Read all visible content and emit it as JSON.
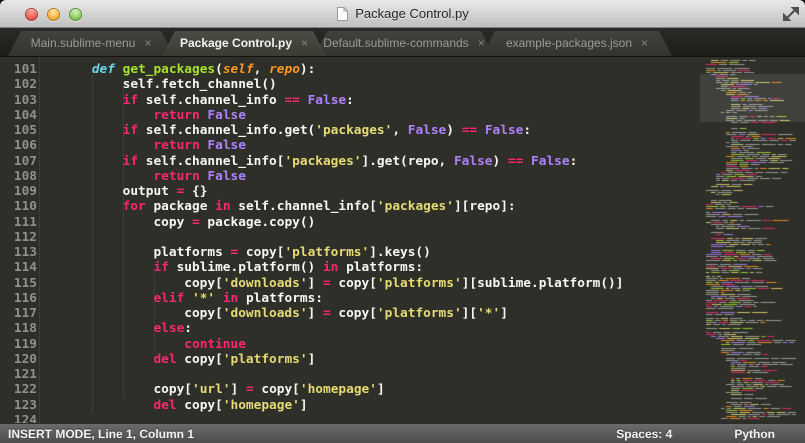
{
  "window": {
    "title": "Package Control.py"
  },
  "window_controls": {
    "close": "close",
    "minimize": "minimize",
    "zoom": "zoom"
  },
  "tabs": [
    {
      "label": "Main.sublime-menu",
      "close": "×",
      "active": false
    },
    {
      "label": "Package Control.py",
      "close": "×",
      "active": true
    },
    {
      "label": "Default.sublime-commands",
      "close": "×",
      "active": false
    },
    {
      "label": "example-packages.json",
      "close": "×",
      "active": false
    }
  ],
  "editor": {
    "first_line": 101,
    "lines": [
      [
        [
          "pl",
          "    "
        ],
        [
          "st",
          "def "
        ],
        [
          "fn",
          "get_packages"
        ],
        [
          "pl",
          "("
        ],
        [
          "pa",
          "self"
        ],
        [
          "pl",
          ", "
        ],
        [
          "pa",
          "repo"
        ],
        [
          "pl",
          "):"
        ]
      ],
      [
        [
          "pl",
          "        self.fetch_channel()"
        ]
      ],
      [
        [
          "pl",
          "        "
        ],
        [
          "kw",
          "if"
        ],
        [
          "pl",
          " self.channel_info "
        ],
        [
          "kw",
          "=="
        ],
        [
          "pl",
          " "
        ],
        [
          "co",
          "False"
        ],
        [
          "pl",
          ":"
        ]
      ],
      [
        [
          "pl",
          "            "
        ],
        [
          "kw",
          "return"
        ],
        [
          "pl",
          " "
        ],
        [
          "co",
          "False"
        ]
      ],
      [
        [
          "pl",
          "        "
        ],
        [
          "kw",
          "if"
        ],
        [
          "pl",
          " self.channel_info.get("
        ],
        [
          "sr",
          "'packages'"
        ],
        [
          "pl",
          ", "
        ],
        [
          "co",
          "False"
        ],
        [
          "pl",
          ") "
        ],
        [
          "kw",
          "=="
        ],
        [
          "pl",
          " "
        ],
        [
          "co",
          "False"
        ],
        [
          "pl",
          ":"
        ]
      ],
      [
        [
          "pl",
          "            "
        ],
        [
          "kw",
          "return"
        ],
        [
          "pl",
          " "
        ],
        [
          "co",
          "False"
        ]
      ],
      [
        [
          "pl",
          "        "
        ],
        [
          "kw",
          "if"
        ],
        [
          "pl",
          " self.channel_info["
        ],
        [
          "sr",
          "'packages'"
        ],
        [
          "pl",
          "].get(repo, "
        ],
        [
          "co",
          "False"
        ],
        [
          "pl",
          ") "
        ],
        [
          "kw",
          "=="
        ],
        [
          "pl",
          " "
        ],
        [
          "co",
          "False"
        ],
        [
          "pl",
          ":"
        ]
      ],
      [
        [
          "pl",
          "            "
        ],
        [
          "kw",
          "return"
        ],
        [
          "pl",
          " "
        ],
        [
          "co",
          "False"
        ]
      ],
      [
        [
          "pl",
          "        output "
        ],
        [
          "kw",
          "="
        ],
        [
          "pl",
          " {}"
        ]
      ],
      [
        [
          "pl",
          "        "
        ],
        [
          "kw",
          "for"
        ],
        [
          "pl",
          " package "
        ],
        [
          "kw",
          "in"
        ],
        [
          "pl",
          " self.channel_info["
        ],
        [
          "sr",
          "'packages'"
        ],
        [
          "pl",
          "][repo]:"
        ]
      ],
      [
        [
          "pl",
          "            copy "
        ],
        [
          "kw",
          "="
        ],
        [
          "pl",
          " package.copy()"
        ]
      ],
      [],
      [
        [
          "pl",
          "            platforms "
        ],
        [
          "kw",
          "="
        ],
        [
          "pl",
          " copy["
        ],
        [
          "sr",
          "'platforms'"
        ],
        [
          "pl",
          "].keys()"
        ]
      ],
      [
        [
          "pl",
          "            "
        ],
        [
          "kw",
          "if"
        ],
        [
          "pl",
          " sublime.platform() "
        ],
        [
          "kw",
          "in"
        ],
        [
          "pl",
          " platforms:"
        ]
      ],
      [
        [
          "pl",
          "                copy["
        ],
        [
          "sr",
          "'downloads'"
        ],
        [
          "pl",
          "] "
        ],
        [
          "kw",
          "="
        ],
        [
          "pl",
          " copy["
        ],
        [
          "sr",
          "'platforms'"
        ],
        [
          "pl",
          "][sublime.platform()]"
        ]
      ],
      [
        [
          "pl",
          "            "
        ],
        [
          "kw",
          "elif"
        ],
        [
          "pl",
          " "
        ],
        [
          "sr",
          "'*'"
        ],
        [
          "pl",
          " "
        ],
        [
          "kw",
          "in"
        ],
        [
          "pl",
          " platforms:"
        ]
      ],
      [
        [
          "pl",
          "                copy["
        ],
        [
          "sr",
          "'downloads'"
        ],
        [
          "pl",
          "] "
        ],
        [
          "kw",
          "="
        ],
        [
          "pl",
          " copy["
        ],
        [
          "sr",
          "'platforms'"
        ],
        [
          "pl",
          "]["
        ],
        [
          "sr",
          "'*'"
        ],
        [
          "pl",
          "]"
        ]
      ],
      [
        [
          "pl",
          "            "
        ],
        [
          "kw",
          "else"
        ],
        [
          "pl",
          ":"
        ]
      ],
      [
        [
          "pl",
          "                "
        ],
        [
          "kw",
          "continue"
        ]
      ],
      [
        [
          "pl",
          "            "
        ],
        [
          "kw",
          "del"
        ],
        [
          "pl",
          " copy["
        ],
        [
          "sr",
          "'platforms'"
        ],
        [
          "pl",
          "]"
        ]
      ],
      [],
      [
        [
          "pl",
          "            copy["
        ],
        [
          "sr",
          "'url'"
        ],
        [
          "pl",
          "] "
        ],
        [
          "kw",
          "="
        ],
        [
          "pl",
          " copy["
        ],
        [
          "sr",
          "'homepage'"
        ],
        [
          "pl",
          "]"
        ]
      ],
      [
        [
          "pl",
          "            "
        ],
        [
          "kw",
          "del"
        ],
        [
          "pl",
          " copy["
        ],
        [
          "sr",
          "'homepage'"
        ],
        [
          "pl",
          "]"
        ]
      ],
      []
    ]
  },
  "status_bar": {
    "mode_text": "INSERT MODE, Line 1, Column 1",
    "spaces": "Spaces: 4",
    "syntax": "Python"
  },
  "colors": {
    "background": "#2e2f29",
    "foreground": "#f8f8f2",
    "keyword": "#f92672",
    "storage": "#66d9ef",
    "function": "#a6e22e",
    "parameter": "#fd971f",
    "constant": "#ae81ff",
    "string": "#e6db74",
    "gutter": "#90918b",
    "statusbar": "#5c5c5e",
    "titlebar": "#cfcfcf"
  }
}
